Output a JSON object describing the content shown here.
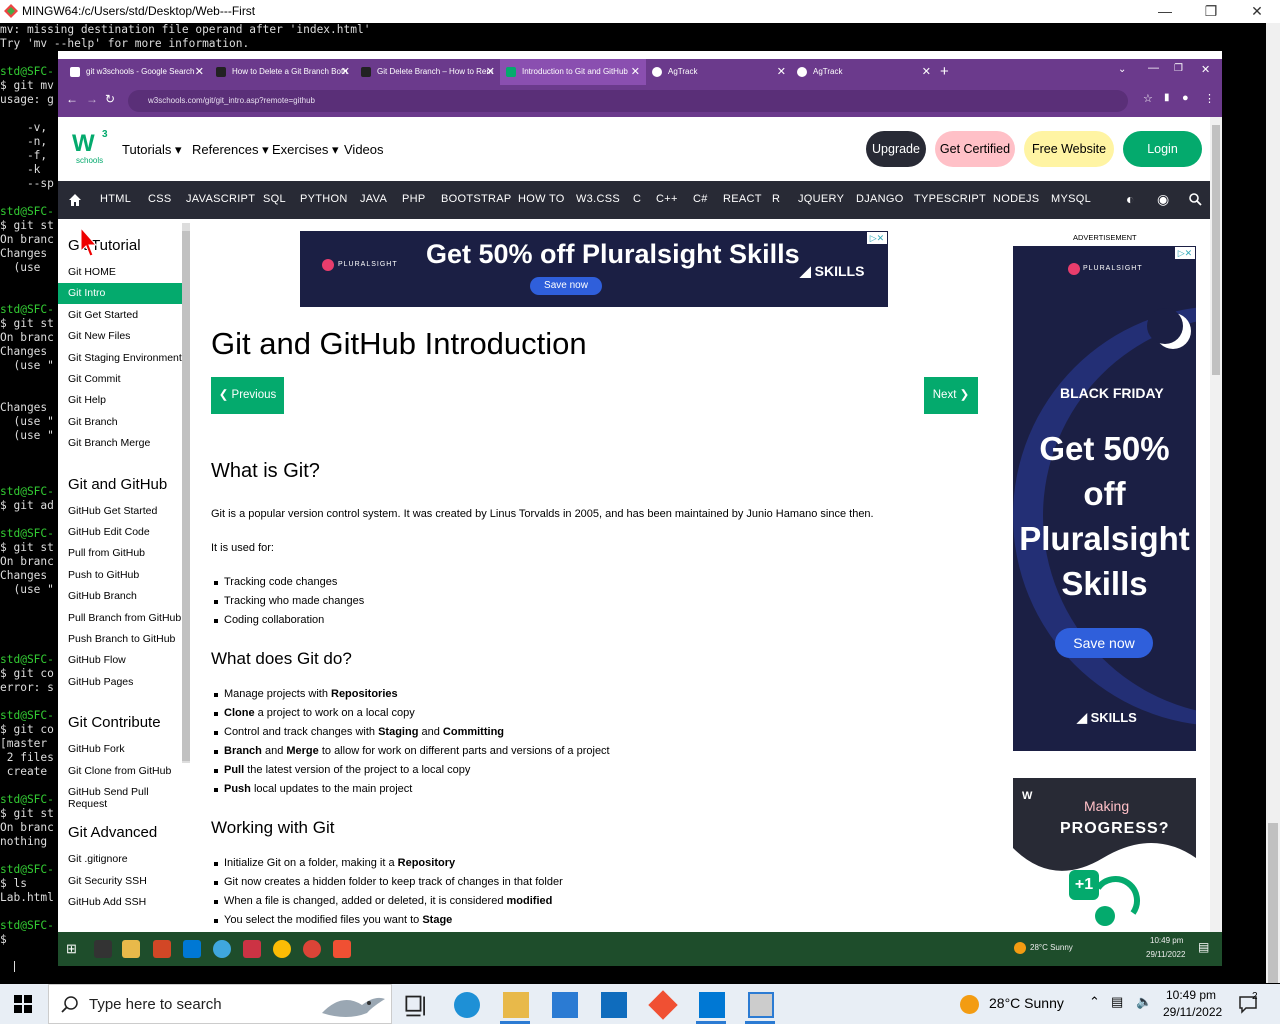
{
  "terminal": {
    "title": "MINGW64:/c/Users/std/Desktop/Web---First",
    "lines": [
      {
        "t": "mv: missing destination file operand after 'index.html'",
        "c": ""
      },
      {
        "t": "Try 'mv --help' for more information.",
        "c": ""
      },
      {
        "t": "",
        "c": ""
      },
      {
        "t": "std@SFC-",
        "c": "g"
      },
      {
        "t": "$ git mv",
        "c": ""
      },
      {
        "t": "usage: g",
        "c": ""
      },
      {
        "t": "",
        "c": ""
      },
      {
        "t": "    -v,",
        "c": ""
      },
      {
        "t": "    -n,",
        "c": ""
      },
      {
        "t": "    -f,",
        "c": ""
      },
      {
        "t": "    -k",
        "c": ""
      },
      {
        "t": "    --sp",
        "c": ""
      },
      {
        "t": "",
        "c": ""
      },
      {
        "t": "std@SFC-",
        "c": "g"
      },
      {
        "t": "$ git st",
        "c": ""
      },
      {
        "t": "On branc",
        "c": ""
      },
      {
        "t": "Changes",
        "c": ""
      },
      {
        "t": "  (use",
        "c": ""
      },
      {
        "t": "",
        "c": ""
      },
      {
        "t": "",
        "c": ""
      },
      {
        "t": "std@SFC-",
        "c": "g"
      },
      {
        "t": "$ git st",
        "c": ""
      },
      {
        "t": "On branc",
        "c": ""
      },
      {
        "t": "Changes",
        "c": ""
      },
      {
        "t": "  (use \"",
        "c": ""
      },
      {
        "t": "",
        "c": ""
      },
      {
        "t": "",
        "c": ""
      },
      {
        "t": "Changes",
        "c": ""
      },
      {
        "t": "  (use \"",
        "c": ""
      },
      {
        "t": "  (use \"",
        "c": ""
      },
      {
        "t": "",
        "c": ""
      },
      {
        "t": "",
        "c": ""
      },
      {
        "t": "",
        "c": ""
      },
      {
        "t": "std@SFC-",
        "c": "g"
      },
      {
        "t": "$ git ad",
        "c": ""
      },
      {
        "t": "",
        "c": ""
      },
      {
        "t": "std@SFC-",
        "c": "g"
      },
      {
        "t": "$ git st",
        "c": ""
      },
      {
        "t": "On branc",
        "c": ""
      },
      {
        "t": "Changes",
        "c": ""
      },
      {
        "t": "  (use \"",
        "c": ""
      },
      {
        "t": "",
        "c": ""
      },
      {
        "t": "",
        "c": ""
      },
      {
        "t": "",
        "c": ""
      },
      {
        "t": "",
        "c": ""
      },
      {
        "t": "std@SFC-",
        "c": "g"
      },
      {
        "t": "$ git co",
        "c": ""
      },
      {
        "t": "error: s",
        "c": ""
      },
      {
        "t": "",
        "c": ""
      },
      {
        "t": "std@SFC-",
        "c": "g"
      },
      {
        "t": "$ git co",
        "c": ""
      },
      {
        "t": "[master",
        "c": ""
      },
      {
        "t": " 2 files",
        "c": ""
      },
      {
        "t": " create",
        "c": ""
      },
      {
        "t": "",
        "c": ""
      },
      {
        "t": "std@SFC-",
        "c": "g"
      },
      {
        "t": "$ git st",
        "c": ""
      },
      {
        "t": "On branc",
        "c": ""
      },
      {
        "t": "nothing",
        "c": ""
      },
      {
        "t": "",
        "c": ""
      },
      {
        "t": "std@SFC-",
        "c": "g"
      },
      {
        "t": "$ ls",
        "c": ""
      },
      {
        "t": "Lab.html",
        "c": ""
      },
      {
        "t": "",
        "c": ""
      },
      {
        "t": "std@SFC-",
        "c": "g"
      },
      {
        "t": "$",
        "c": ""
      }
    ]
  },
  "browser": {
    "tabs": [
      {
        "label": "git w3schools - Google Search"
      },
      {
        "label": "How to Delete a Git Branch Both"
      },
      {
        "label": "Git Delete Branch – How to Rem"
      },
      {
        "label": "Introduction to Git and GitHub"
      },
      {
        "label": "AgTrack"
      },
      {
        "label": "AgTrack"
      }
    ],
    "url": "w3schools.com/git/git_intro.asp?remote=github"
  },
  "w3": {
    "logo_text": "schools",
    "logo_sup": "3",
    "topnav": [
      "Tutorials",
      "References",
      "Exercises",
      "Videos"
    ],
    "buttons": {
      "upgrade": "Upgrade",
      "certified": "Get Certified",
      "website": "Free Website",
      "login": "Login"
    },
    "nav2": [
      "HTML",
      "CSS",
      "JAVASCRIPT",
      "SQL",
      "PYTHON",
      "JAVA",
      "PHP",
      "BOOTSTRAP",
      "HOW TO",
      "W3.CSS",
      "C",
      "C++",
      "C#",
      "REACT",
      "R",
      "JQUERY",
      "DJANGO",
      "TYPESCRIPT",
      "NODEJS",
      "MYSQL"
    ],
    "sidebar": {
      "sections": [
        {
          "heading": "Git Tutorial",
          "items": [
            "Git HOME",
            "Git Intro",
            "Git Get Started",
            "Git New Files",
            "Git Staging Environment",
            "Git Commit",
            "Git Help",
            "Git Branch",
            "Git Branch Merge"
          ]
        },
        {
          "heading": "Git and GitHub",
          "items": [
            "GitHub Get Started",
            "GitHub Edit Code",
            "Pull from GitHub",
            "Push to GitHub",
            "GitHub Branch",
            "Pull Branch from GitHub",
            "Push Branch to GitHub",
            "GitHub Flow",
            "GitHub Pages"
          ]
        },
        {
          "heading": "Git Contribute",
          "items": [
            "GitHub Fork",
            "Git Clone from GitHub",
            "GitHub Send Pull Request"
          ]
        },
        {
          "heading": "Git Advanced",
          "items": [
            "Git .gitignore",
            "Git Security SSH",
            "GitHub Add SSH"
          ]
        }
      ]
    },
    "ad_top": {
      "brand": "PLURALSIGHT",
      "headline": "Get 50% off Pluralsight Skills",
      "cta": "Save now",
      "skills": "SKILLS"
    },
    "page_title": "Git and GitHub Introduction",
    "prev": "❮ Previous",
    "next": "Next ❯",
    "sections": {
      "what_is": "What is Git?",
      "what_is_p": "Git is a popular version control system. It was created by Linus Torvalds in 2005, and has been maintained by Junio Hamano since then.",
      "used_for": "It is used for:",
      "used_list": [
        "Tracking code changes",
        "Tracking who made changes",
        "Coding collaboration"
      ],
      "what_does": "What does Git do?",
      "does_list": [
        {
          "b": "",
          "t": "Manage projects with ",
          "b2": "Repositories",
          "t2": ""
        },
        {
          "b": "Clone",
          "t": " a project to work on a local copy",
          "b2": "",
          "t2": ""
        },
        {
          "b": "",
          "t": "Control and track changes with ",
          "b2": "Staging",
          "t2": " and ",
          "b3": "Committing"
        },
        {
          "b": "Branch",
          "t": " and ",
          "b2": "Merge",
          "t2": " to allow for work on different parts and versions of a project"
        },
        {
          "b": "Pull",
          "t": " the latest version of the project to a local copy",
          "b2": "",
          "t2": ""
        },
        {
          "b": "Push",
          "t": " local updates to the main project",
          "b2": "",
          "t2": ""
        }
      ],
      "working": "Working with Git",
      "working_list": [
        {
          "t": "Initialize Git on a folder, making it a ",
          "b": "Repository"
        },
        {
          "t": "Git now creates a hidden folder to keep track of changes in that folder",
          "b": ""
        },
        {
          "t": "When a file is changed, added or deleted, it is considered ",
          "b": "modified"
        },
        {
          "t": "You select the modified files you want to ",
          "b": "Stage"
        }
      ]
    },
    "ad_side": {
      "label": "ADVERTISEMENT",
      "brand": "PLURALSIGHT",
      "black_friday": "BLACK FRIDAY",
      "headline": "Get 50% off Pluralsight Skills",
      "cta": "Save now",
      "skills": "SKILLS"
    },
    "ad_bottom": {
      "making": "Making",
      "progress": "PROGRESS?",
      "plus": "+1"
    }
  },
  "inner_taskbar": {
    "weather": "28°C Sunny",
    "time": "10:49 pm",
    "date": "29/11/2022"
  },
  "taskbar": {
    "search_placeholder": "Type here to search",
    "weather": "28°C  Sunny",
    "time": "10:49 pm",
    "date": "29/11/2022",
    "notif_count": "2"
  },
  "colors": {
    "w3_green": "#04aa6d",
    "browser_purple": "#6b3a8c",
    "nav_dark": "#282a35",
    "terminal_green": "#33cc33"
  }
}
